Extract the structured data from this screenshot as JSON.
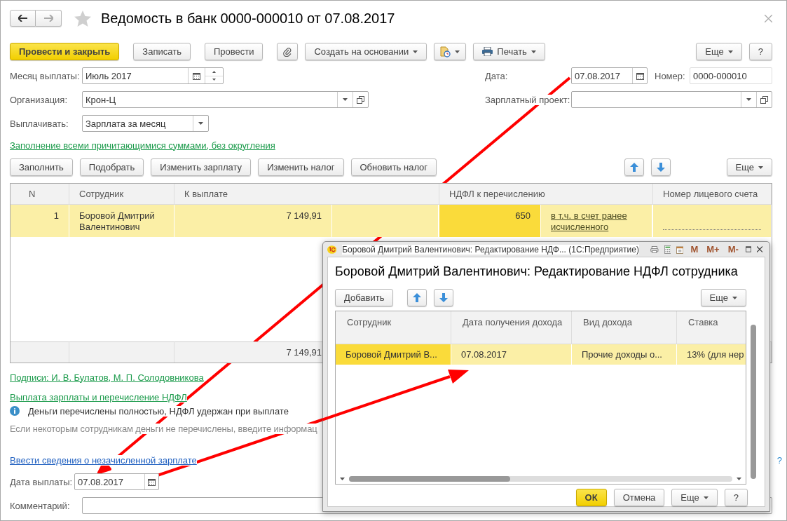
{
  "window": {
    "title": "Ведомость в банк 0000-000010 от 07.08.2017",
    "favorite": false
  },
  "toolbar": [
    {
      "kind": "primary",
      "label": "Провести и закрыть"
    },
    {
      "kind": "button",
      "label": "Записать"
    },
    {
      "kind": "button",
      "label": "Провести"
    },
    {
      "kind": "attach"
    },
    {
      "kind": "menu",
      "label": "Создать на основании"
    },
    {
      "kind": "report-menu"
    },
    {
      "kind": "print-menu",
      "label": "Печать"
    }
  ],
  "toolbar_right": [
    {
      "kind": "menu",
      "label": "Еще"
    },
    {
      "kind": "button",
      "label": "?"
    }
  ],
  "fields": {
    "month": {
      "label": "Месяц выплаты:",
      "value": "Июль 2017"
    },
    "organization": {
      "label": "Организация:",
      "value": "Крон-Ц"
    },
    "pay": {
      "label": "Выплачивать:",
      "value": "Зарплата за месяц"
    },
    "date": {
      "label": "Дата:",
      "value": "07.08.2017"
    },
    "number": {
      "label": "Номер:",
      "value": "0000-000010"
    },
    "salary_project": {
      "label": "Зарплатный проект:"
    }
  },
  "fill_link": "Заполнение всеми причитающимися суммами, без округления",
  "table_buttons": [
    "Заполнить",
    "Подобрать",
    "Изменить зарплату",
    "Изменить налог",
    "Обновить налог"
  ],
  "table_more": "Еще",
  "table": {
    "columns": [
      "N",
      "Сотрудник",
      "К выплате",
      "НДФЛ к перечислению",
      "Номер лицевого счета"
    ],
    "rows": [
      {
        "selected": true,
        "cells": [
          {
            "text": "1",
            "focused": false
          },
          {
            "text": "Боровой Дмитрий Валентинович",
            "focused": false
          },
          {
            "text": "7 149,91",
            "focused": false
          },
          {
            "text": "650",
            "link": "в т.ч. в счет ранее исчисленного",
            "focused": true
          },
          {
            "kind": "input",
            "focused": false
          }
        ]
      }
    ],
    "totals": {
      "amount": "7 149,91"
    }
  },
  "signatures_link": "Подписи: И. В. Булатов, М. П. Солодовникова",
  "payment_link": "Выплата зарплаты и перечисление НДФЛ",
  "info": "Деньги перечислены  полностью, НДФЛ удержан при выплате",
  "hint": "Если некоторым сотрудникам деньги не перечислены, введите информац",
  "unpaid_link": "Ввести сведения о незачисленной зарплате",
  "help_link": "?",
  "payment_date": {
    "label": "Дата выплаты:",
    "value": "07.08.2017"
  },
  "comment": {
    "label": "Комментарий:"
  },
  "dialog": {
    "window_title": "Боровой Дмитрий Валентинович: Редактирование НДФ... (1С:Предприятие)",
    "memory_buttons": [
      "M",
      "M+",
      "M-"
    ],
    "heading": "Боровой Дмитрий Валентинович: Редактирование НДФЛ сотрудника",
    "add": "Добавить",
    "more": "Еще",
    "columns": [
      "Сотрудник",
      "Дата получения дохода",
      "Вид дохода",
      "Ставка"
    ],
    "rows": [
      {
        "selected": true,
        "cells": [
          {
            "text": "Боровой Дмитрий В...",
            "focused": true
          },
          {
            "text": "07.08.2017",
            "focused": false
          },
          {
            "text": "Прочие доходы о...",
            "focused": false
          },
          {
            "text": "13% (для нер",
            "focused": false
          }
        ]
      }
    ],
    "buttons": [
      {
        "kind": "primary",
        "label": "ОК"
      },
      {
        "kind": "button",
        "label": "Отмена"
      },
      {
        "kind": "menu",
        "label": "Еще"
      },
      {
        "kind": "button",
        "label": "?"
      }
    ]
  }
}
